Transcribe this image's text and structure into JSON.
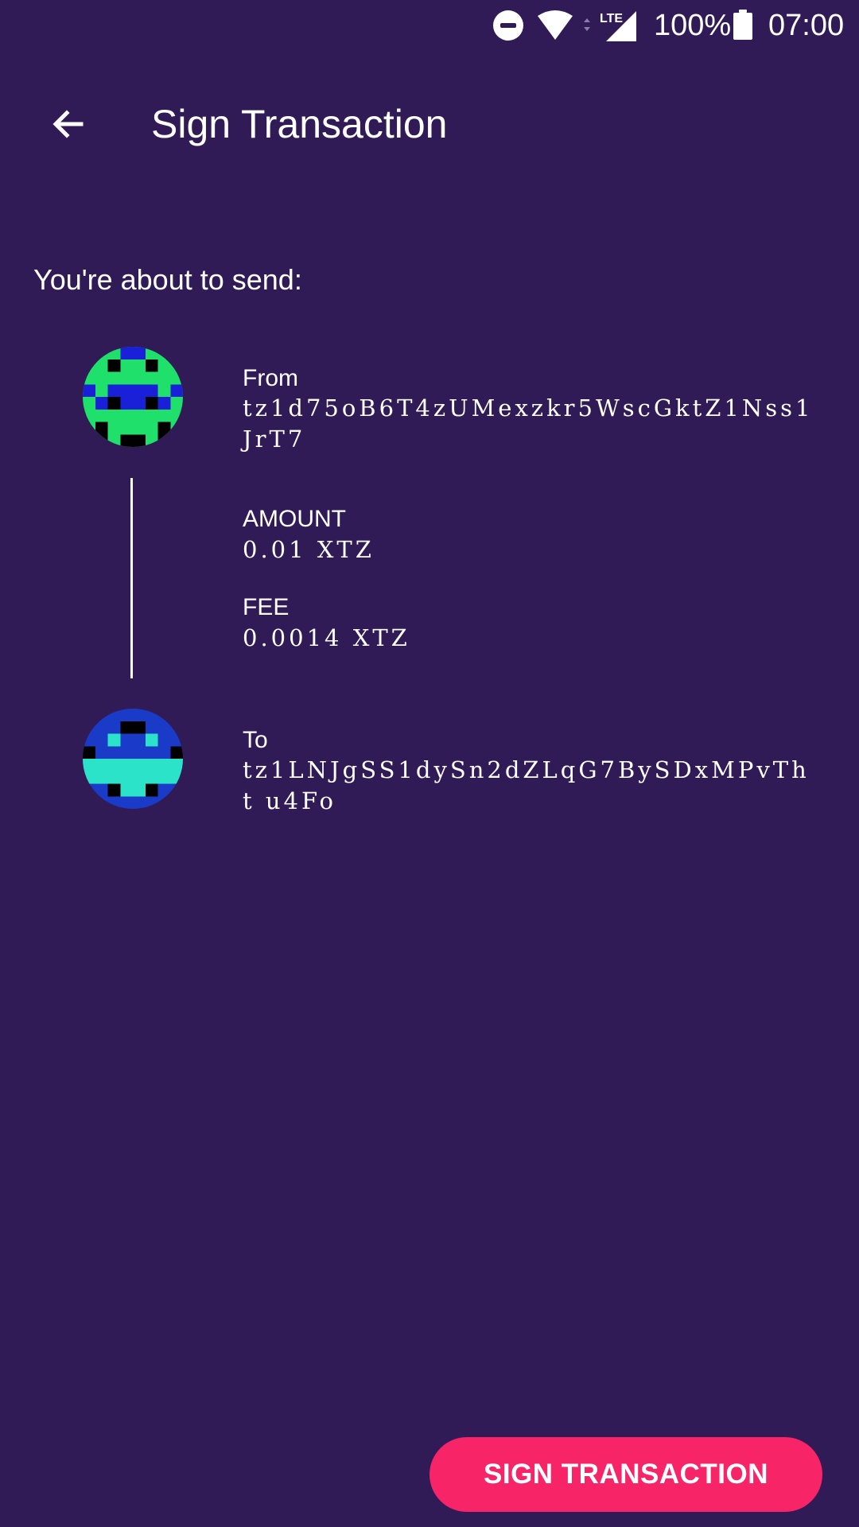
{
  "status_bar": {
    "battery_percent": "100%",
    "time": "07:00",
    "network_label": "LTE",
    "icons": [
      "do-not-disturb-icon",
      "wifi-icon",
      "lte-signal-icon",
      "battery-icon"
    ]
  },
  "toolbar": {
    "back_icon": "arrow-left-icon",
    "title": "Sign Transaction"
  },
  "intro": "You're about to send:",
  "transaction": {
    "from": {
      "label": "From",
      "address": "tz1d75oB6T4zUMexzkr5WscGktZ1Nss1JrT7",
      "avatar_colors": [
        "#1FE06B",
        "#1A1FD8",
        "#000000"
      ]
    },
    "amount": {
      "label": "AMOUNT",
      "value": "0.01 XTZ"
    },
    "fee": {
      "label": "FEE",
      "value": "0.0014 XTZ"
    },
    "to": {
      "label": "To",
      "address": "tz1LNJgSS1dySn2dZLqG7BySDxMPvTht u4Fo",
      "avatar_colors": [
        "#2BE3C9",
        "#1A3BC8",
        "#000000"
      ]
    }
  },
  "sign_button": {
    "label": "SIGN TRANSACTION"
  },
  "colors": {
    "background": "#311B57",
    "accent": "#F72468",
    "text": "#FFFFFF"
  }
}
